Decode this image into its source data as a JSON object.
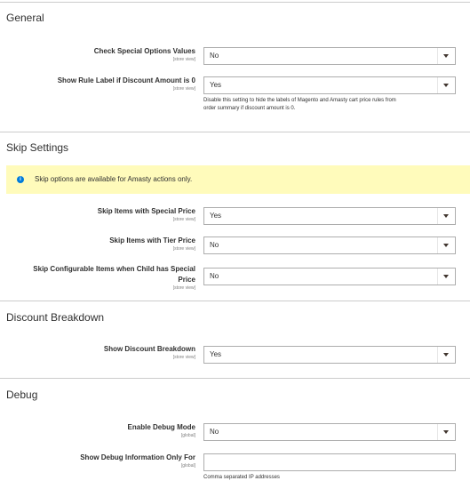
{
  "sections": {
    "general": {
      "title": "General",
      "check_special": {
        "label": "Check Special Options Values",
        "scope": "[store view]",
        "value": "No"
      },
      "show_rule_label": {
        "label": "Show Rule Label if Discount Amount is 0",
        "scope": "[store view]",
        "value": "Yes",
        "note_line1": "Disable this setting to hide the labels of Magento and Amasty cart price rules from",
        "note_line2": "order summary if discount amount is 0."
      }
    },
    "skip": {
      "title": "Skip Settings",
      "notice": "Skip options are available for Amasty actions only.",
      "special_price": {
        "label": "Skip Items with Special Price",
        "scope": "[store view]",
        "value": "Yes"
      },
      "tier_price": {
        "label": "Skip Items with Tier Price",
        "scope": "[store view]",
        "value": "No"
      },
      "configurable": {
        "label_line1": "Skip Configurable Items when Child has Special",
        "label_line2": "Price",
        "scope": "[store view]",
        "value": "No"
      }
    },
    "breakdown": {
      "title": "Discount Breakdown",
      "show": {
        "label": "Show Discount Breakdown",
        "scope": "[store view]",
        "value": "Yes"
      }
    },
    "debug": {
      "title": "Debug",
      "mode": {
        "label": "Enable Debug Mode",
        "scope": "[global]",
        "value": "No"
      },
      "ips": {
        "label": "Show Debug Information Only For",
        "scope": "[global]",
        "value": "",
        "note": "Comma separated IP addresses"
      }
    }
  },
  "icons": {
    "info": "info-icon",
    "dropdown": "chevron-down-icon"
  },
  "colors": {
    "notice_bg": "#fffbbb",
    "info_blue": "#007bdb",
    "border": "#adadad"
  }
}
